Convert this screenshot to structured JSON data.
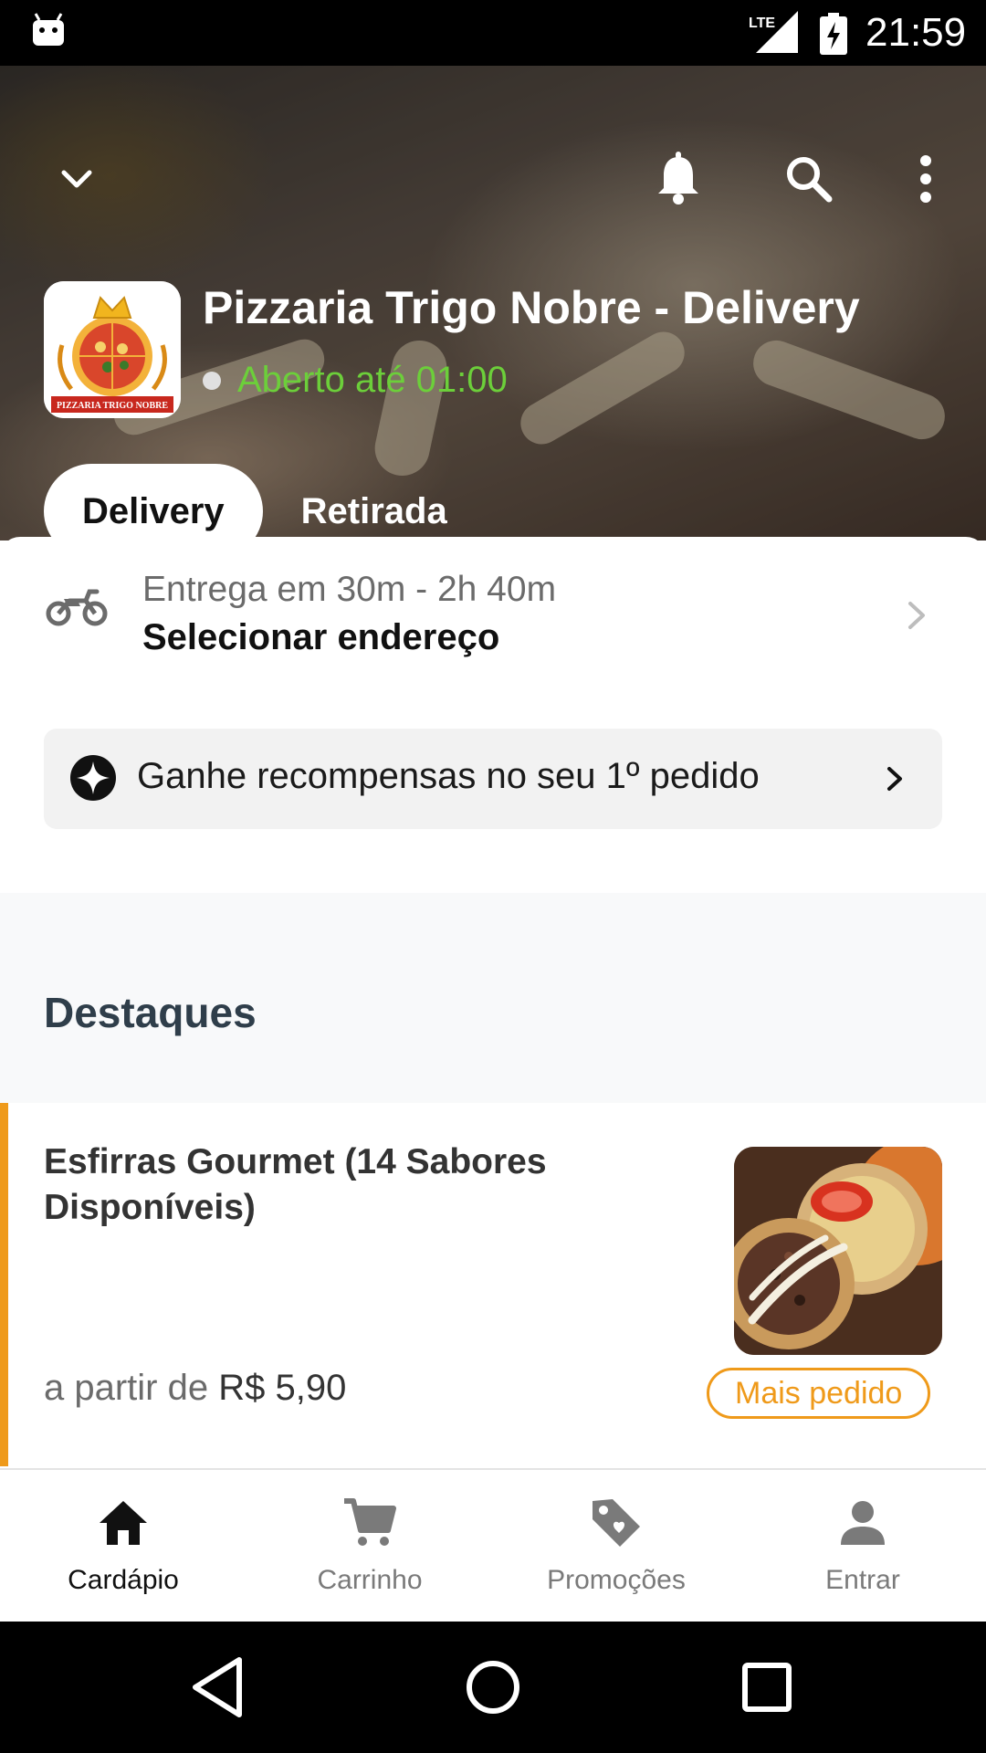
{
  "status_bar": {
    "time": "21:59",
    "network": "LTE",
    "icons": [
      "android-debug-icon",
      "lte-signal-icon",
      "battery-charging-icon"
    ]
  },
  "header": {
    "store_name": "Pizzaria Trigo Nobre - Delivery",
    "open_status": "Aberto até 01:00",
    "logo_text": "PIZZARIA TRIGO NOBRE",
    "icons": [
      "chevron-down-icon",
      "bell-icon",
      "search-icon",
      "more-vert-icon"
    ],
    "mode_tabs": [
      {
        "label": "Delivery",
        "active": true
      },
      {
        "label": "Retirada",
        "active": false
      }
    ]
  },
  "delivery": {
    "eta": "Entrega em 30m - 2h 40m",
    "address_prompt": "Selecionar endereço",
    "icon": "motorcycle-icon"
  },
  "rewards": {
    "label": "Ganhe recompensas no seu 1º pedido",
    "icon": "sparkle-icon"
  },
  "highlights": {
    "title": "Destaques",
    "products": [
      {
        "name": "Esfirras Gourmet (14 Sabores Disponíveis)",
        "price_prefix": "a partir de",
        "price": "R$ 5,90",
        "badge": "Mais pedido"
      }
    ]
  },
  "bottom_nav": [
    {
      "label": "Cardápio",
      "icon": "home-icon",
      "active": true
    },
    {
      "label": "Carrinho",
      "icon": "cart-icon",
      "active": false
    },
    {
      "label": "Promoções",
      "icon": "tag-icon",
      "active": false
    },
    {
      "label": "Entrar",
      "icon": "person-icon",
      "active": false
    }
  ],
  "colors": {
    "accent": "#ef9a1a",
    "open_green": "#6ccf3a",
    "section_title": "#2f3e4a"
  }
}
